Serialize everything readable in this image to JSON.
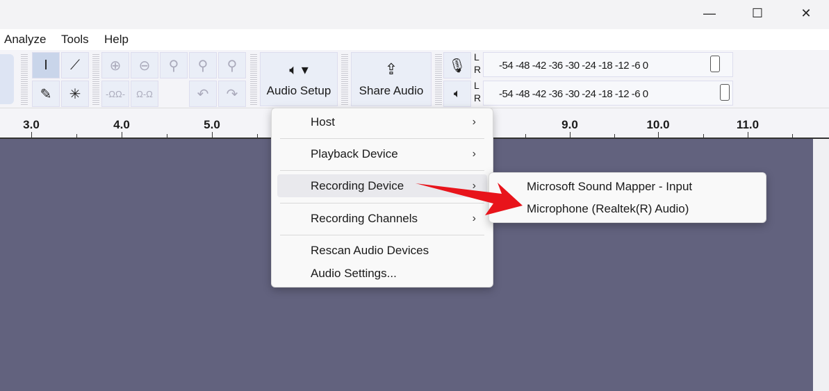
{
  "window": {
    "minimize": "—",
    "maximize": "☐",
    "close": "✕"
  },
  "menubar": [
    "Analyze",
    "Tools",
    "Help"
  ],
  "toolbar": {
    "audio_setup": "Audio Setup",
    "share_audio": "Share Audio",
    "meter_ticks": "-54 -48 -42 -36 -30 -24 -18 -12 -6 0",
    "L": "L",
    "R": "R"
  },
  "ruler": [
    "3.0",
    "4.0",
    "5.0",
    "9.0",
    "10.0",
    "11.0"
  ],
  "context_menu": {
    "items": [
      "Host",
      "Playback Device",
      "Recording Device",
      "Recording Channels",
      "Rescan Audio Devices",
      "Audio Settings..."
    ],
    "chevron": "›"
  },
  "submenu": {
    "items": [
      "Microsoft Sound Mapper - Input",
      "Microphone (Realtek(R) Audio)"
    ]
  },
  "colors": {
    "track_bg": "#62627e",
    "arrow": "#e8141b"
  }
}
